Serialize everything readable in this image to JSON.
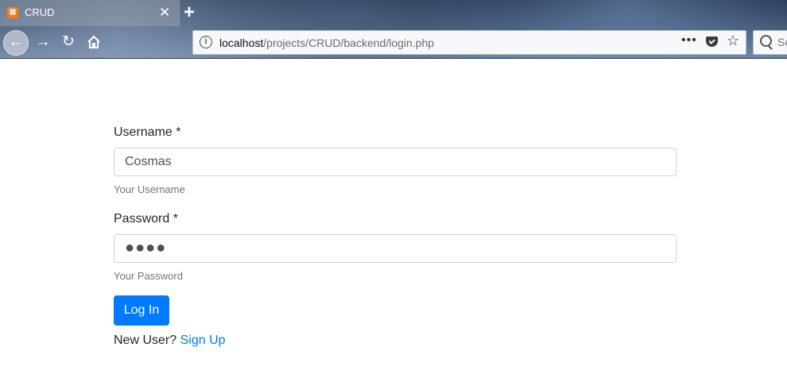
{
  "browser": {
    "tab": {
      "title": "CRUD",
      "favicon": "xampp-icon",
      "close": "✕"
    },
    "new_tab": "+",
    "nav": {
      "back": "back-arrow-icon",
      "forward": "forward-arrow-icon",
      "reload": "reload-icon",
      "home": "home-icon"
    },
    "url": {
      "host": "localhost",
      "path": "/projects/CRUD/backend/login.php"
    },
    "page_actions": "•••",
    "search": {
      "placeholder": "Se"
    }
  },
  "form": {
    "username": {
      "label": "Username *",
      "value": "Cosmas",
      "help": "Your Username"
    },
    "password": {
      "label": "Password *",
      "masked_value": "●●●●",
      "help": "Your Password"
    },
    "submit_label": "Log In",
    "signup": {
      "prompt": "New User?",
      "link_text": "Sign Up"
    }
  },
  "colors": {
    "primary": "#007bff",
    "text": "#212529",
    "muted": "#6c757d",
    "input_border": "#ced4da"
  }
}
